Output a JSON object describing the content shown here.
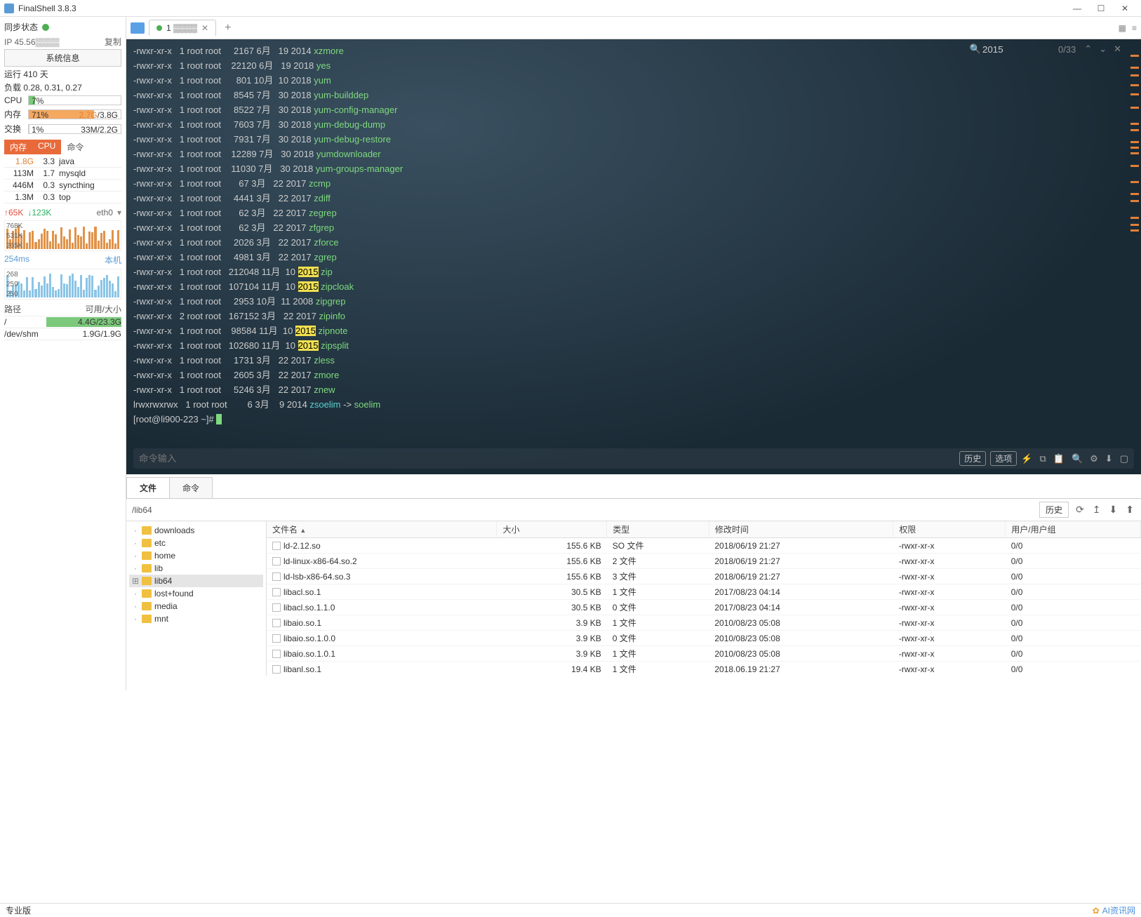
{
  "window": {
    "title": "FinalShell 3.8.3"
  },
  "sidebar": {
    "sync": "同步状态",
    "ip_label": "IP",
    "ip": "45.56",
    "copy": "复制",
    "sysinfo_btn": "系统信息",
    "uptime": "运行 410 天",
    "load": "负载 0.28, 0.31, 0.27",
    "cpu": {
      "label": "CPU",
      "val": "7%",
      "pct": 7
    },
    "mem": {
      "label": "内存",
      "val": "71%",
      "pct": 71,
      "used": "2.7G",
      "total": "3.8G"
    },
    "swap": {
      "label": "交换",
      "val": "1%",
      "pct": 1,
      "used": "33M",
      "total": "2.2G"
    },
    "proc_headers": {
      "mem": "内存",
      "cpu": "CPU",
      "cmd": "命令"
    },
    "procs": [
      {
        "mem": "1.8G",
        "cpu": "3.3",
        "cmd": "java",
        "mem_cls": "orange"
      },
      {
        "mem": "113M",
        "cpu": "1.7",
        "cmd": "mysqld"
      },
      {
        "mem": "446M",
        "cpu": "0.3",
        "cmd": "syncthing"
      },
      {
        "mem": "1.3M",
        "cpu": "0.3",
        "cmd": "top"
      }
    ],
    "net": {
      "up": "65K",
      "down": "123K",
      "iface": "eth0"
    },
    "net_y": [
      "768K",
      "531K",
      "265K"
    ],
    "ping": {
      "val": "254ms",
      "label": "本机"
    },
    "ping_y": [
      "268",
      "259",
      "250"
    ],
    "disk_headers": {
      "path": "路径",
      "size": "可用/大小"
    },
    "disks": [
      {
        "path": "/",
        "size": "4.4G/23.3G",
        "warn": true
      },
      {
        "path": "/dev/shm",
        "size": "1.9G/1.9G"
      }
    ]
  },
  "tab": {
    "name": "1",
    "num": "1"
  },
  "search": {
    "query": "2015",
    "count": "0/33"
  },
  "terminal": {
    "rows": [
      {
        "perm": "-rwxr-xr-x",
        "l": "1",
        "u": "root",
        "g": "root",
        "sz": "2167",
        "m": "6月",
        "d": "19",
        "y": "2014",
        "f": "xzmore"
      },
      {
        "perm": "-rwxr-xr-x",
        "l": "1",
        "u": "root",
        "g": "root",
        "sz": "22120",
        "m": "6月",
        "d": "19",
        "y": "2018",
        "f": "yes"
      },
      {
        "perm": "-rwxr-xr-x",
        "l": "1",
        "u": "root",
        "g": "root",
        "sz": "801",
        "m": "10月",
        "d": "10",
        "y": "2018",
        "f": "yum"
      },
      {
        "perm": "-rwxr-xr-x",
        "l": "1",
        "u": "root",
        "g": "root",
        "sz": "8545",
        "m": "7月",
        "d": "30",
        "y": "2018",
        "f": "yum-builddep"
      },
      {
        "perm": "-rwxr-xr-x",
        "l": "1",
        "u": "root",
        "g": "root",
        "sz": "8522",
        "m": "7月",
        "d": "30",
        "y": "2018",
        "f": "yum-config-manager"
      },
      {
        "perm": "-rwxr-xr-x",
        "l": "1",
        "u": "root",
        "g": "root",
        "sz": "7603",
        "m": "7月",
        "d": "30",
        "y": "2018",
        "f": "yum-debug-dump"
      },
      {
        "perm": "-rwxr-xr-x",
        "l": "1",
        "u": "root",
        "g": "root",
        "sz": "7931",
        "m": "7月",
        "d": "30",
        "y": "2018",
        "f": "yum-debug-restore"
      },
      {
        "perm": "-rwxr-xr-x",
        "l": "1",
        "u": "root",
        "g": "root",
        "sz": "12289",
        "m": "7月",
        "d": "30",
        "y": "2018",
        "f": "yumdownloader"
      },
      {
        "perm": "-rwxr-xr-x",
        "l": "1",
        "u": "root",
        "g": "root",
        "sz": "11030",
        "m": "7月",
        "d": "30",
        "y": "2018",
        "f": "yum-groups-manager"
      },
      {
        "perm": "-rwxr-xr-x",
        "l": "1",
        "u": "root",
        "g": "root",
        "sz": "67",
        "m": "3月",
        "d": "22",
        "y": "2017",
        "f": "zcmp"
      },
      {
        "perm": "-rwxr-xr-x",
        "l": "1",
        "u": "root",
        "g": "root",
        "sz": "4441",
        "m": "3月",
        "d": "22",
        "y": "2017",
        "f": "zdiff"
      },
      {
        "perm": "-rwxr-xr-x",
        "l": "1",
        "u": "root",
        "g": "root",
        "sz": "62",
        "m": "3月",
        "d": "22",
        "y": "2017",
        "f": "zegrep"
      },
      {
        "perm": "-rwxr-xr-x",
        "l": "1",
        "u": "root",
        "g": "root",
        "sz": "62",
        "m": "3月",
        "d": "22",
        "y": "2017",
        "f": "zfgrep"
      },
      {
        "perm": "-rwxr-xr-x",
        "l": "1",
        "u": "root",
        "g": "root",
        "sz": "2026",
        "m": "3月",
        "d": "22",
        "y": "2017",
        "f": "zforce"
      },
      {
        "perm": "-rwxr-xr-x",
        "l": "1",
        "u": "root",
        "g": "root",
        "sz": "4981",
        "m": "3月",
        "d": "22",
        "y": "2017",
        "f": "zgrep"
      },
      {
        "perm": "-rwxr-xr-x",
        "l": "1",
        "u": "root",
        "g": "root",
        "sz": "212048",
        "m": "11月",
        "d": "10",
        "y": "2015",
        "f": "zip",
        "hl": true
      },
      {
        "perm": "-rwxr-xr-x",
        "l": "1",
        "u": "root",
        "g": "root",
        "sz": "107104",
        "m": "11月",
        "d": "10",
        "y": "2015",
        "f": "zipcloak",
        "hl": true
      },
      {
        "perm": "-rwxr-xr-x",
        "l": "1",
        "u": "root",
        "g": "root",
        "sz": "2953",
        "m": "10月",
        "d": "11",
        "y": "2008",
        "f": "zipgrep"
      },
      {
        "perm": "-rwxr-xr-x",
        "l": "2",
        "u": "root",
        "g": "root",
        "sz": "167152",
        "m": "3月",
        "d": "22",
        "y": "2017",
        "f": "zipinfo"
      },
      {
        "perm": "-rwxr-xr-x",
        "l": "1",
        "u": "root",
        "g": "root",
        "sz": "98584",
        "m": "11月",
        "d": "10",
        "y": "2015",
        "f": "zipnote",
        "hl": true
      },
      {
        "perm": "-rwxr-xr-x",
        "l": "1",
        "u": "root",
        "g": "root",
        "sz": "102680",
        "m": "11月",
        "d": "10",
        "y": "2015",
        "f": "zipsplit",
        "hl": true
      },
      {
        "perm": "-rwxr-xr-x",
        "l": "1",
        "u": "root",
        "g": "root",
        "sz": "1731",
        "m": "3月",
        "d": "22",
        "y": "2017",
        "f": "zless"
      },
      {
        "perm": "-rwxr-xr-x",
        "l": "1",
        "u": "root",
        "g": "root",
        "sz": "2605",
        "m": "3月",
        "d": "22",
        "y": "2017",
        "f": "zmore"
      },
      {
        "perm": "-rwxr-xr-x",
        "l": "1",
        "u": "root",
        "g": "root",
        "sz": "5246",
        "m": "3月",
        "d": "22",
        "y": "2017",
        "f": "znew"
      },
      {
        "perm": "lrwxrwxrwx",
        "l": "1",
        "u": "root",
        "g": "root",
        "sz": "6",
        "m": "3月",
        "d": "9",
        "y": "2014",
        "f": "zsoelim",
        "link": "soelim",
        "cyan": true
      }
    ],
    "prompt": "[root@li900-223 ~]# "
  },
  "cmdbar": {
    "placeholder": "命令输入",
    "history": "历史",
    "options": "选项"
  },
  "lower": {
    "tabs": [
      "文件",
      "命令"
    ],
    "path": "/lib64",
    "history": "历史"
  },
  "tree": [
    "downloads",
    "etc",
    "home",
    "lib",
    "lib64",
    "lost+found",
    "media",
    "mnt"
  ],
  "tree_sel": 4,
  "filecols": {
    "name": "文件名",
    "size": "大小",
    "type": "类型",
    "mtime": "修改时间",
    "perm": "权限",
    "owner": "用户/用户组"
  },
  "files": [
    {
      "name": "ld-2.12.so",
      "size": "155.6 KB",
      "type": "SO 文件",
      "mtime": "2018/06/19 21:27",
      "perm": "-rwxr-xr-x",
      "owner": "0/0"
    },
    {
      "name": "ld-linux-x86-64.so.2",
      "size": "155.6 KB",
      "type": "2 文件",
      "mtime": "2018/06/19 21:27",
      "perm": "-rwxr-xr-x",
      "owner": "0/0"
    },
    {
      "name": "ld-lsb-x86-64.so.3",
      "size": "155.6 KB",
      "type": "3 文件",
      "mtime": "2018/06/19 21:27",
      "perm": "-rwxr-xr-x",
      "owner": "0/0"
    },
    {
      "name": "libacl.so.1",
      "size": "30.5 KB",
      "type": "1 文件",
      "mtime": "2017/08/23 04:14",
      "perm": "-rwxr-xr-x",
      "owner": "0/0"
    },
    {
      "name": "libacl.so.1.1.0",
      "size": "30.5 KB",
      "type": "0 文件",
      "mtime": "2017/08/23 04:14",
      "perm": "-rwxr-xr-x",
      "owner": "0/0"
    },
    {
      "name": "libaio.so.1",
      "size": "3.9 KB",
      "type": "1 文件",
      "mtime": "2010/08/23 05:08",
      "perm": "-rwxr-xr-x",
      "owner": "0/0"
    },
    {
      "name": "libaio.so.1.0.0",
      "size": "3.9 KB",
      "type": "0 文件",
      "mtime": "2010/08/23 05:08",
      "perm": "-rwxr-xr-x",
      "owner": "0/0"
    },
    {
      "name": "libaio.so.1.0.1",
      "size": "3.9 KB",
      "type": "1 文件",
      "mtime": "2010/08/23 05:08",
      "perm": "-rwxr-xr-x",
      "owner": "0/0"
    },
    {
      "name": "libanl.so.1",
      "size": "19.4 KB",
      "type": "1 文件",
      "mtime": "2018.06.19 21:27",
      "perm": "-rwxr-xr-x",
      "owner": "0/0"
    }
  ],
  "footer": {
    "edition": "专业版",
    "brand": "AI资讯网"
  }
}
